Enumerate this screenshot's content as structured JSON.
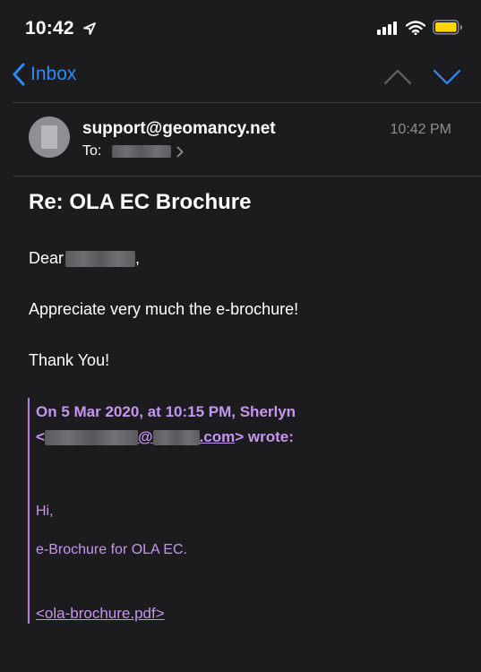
{
  "status_bar": {
    "time": "10:42",
    "battery_color": "#ffd60a"
  },
  "nav": {
    "back_label": "Inbox",
    "accent_color": "#2e8cf6"
  },
  "header": {
    "sender": "support@geomancy.net",
    "to_label": "To:",
    "time": "10:42 PM"
  },
  "message": {
    "subject": "Re:  OLA EC Brochure",
    "greeting_prefix": "Dear",
    "greeting_suffix": ",",
    "body_line1": "Appreciate very much the e-brochure!",
    "body_line2": "Thank You!"
  },
  "quoted": {
    "header_line1": "On 5 Mar 2020, at 10:15 PM, Sherlyn",
    "header_lt": "<",
    "header_at": "@",
    "header_domain": ".com",
    "header_end": "> wrote:",
    "hi": "Hi,",
    "line": "e-Brochure for OLA EC.",
    "attachment": "<ola-brochure.pdf>",
    "color": "#c695f2"
  }
}
